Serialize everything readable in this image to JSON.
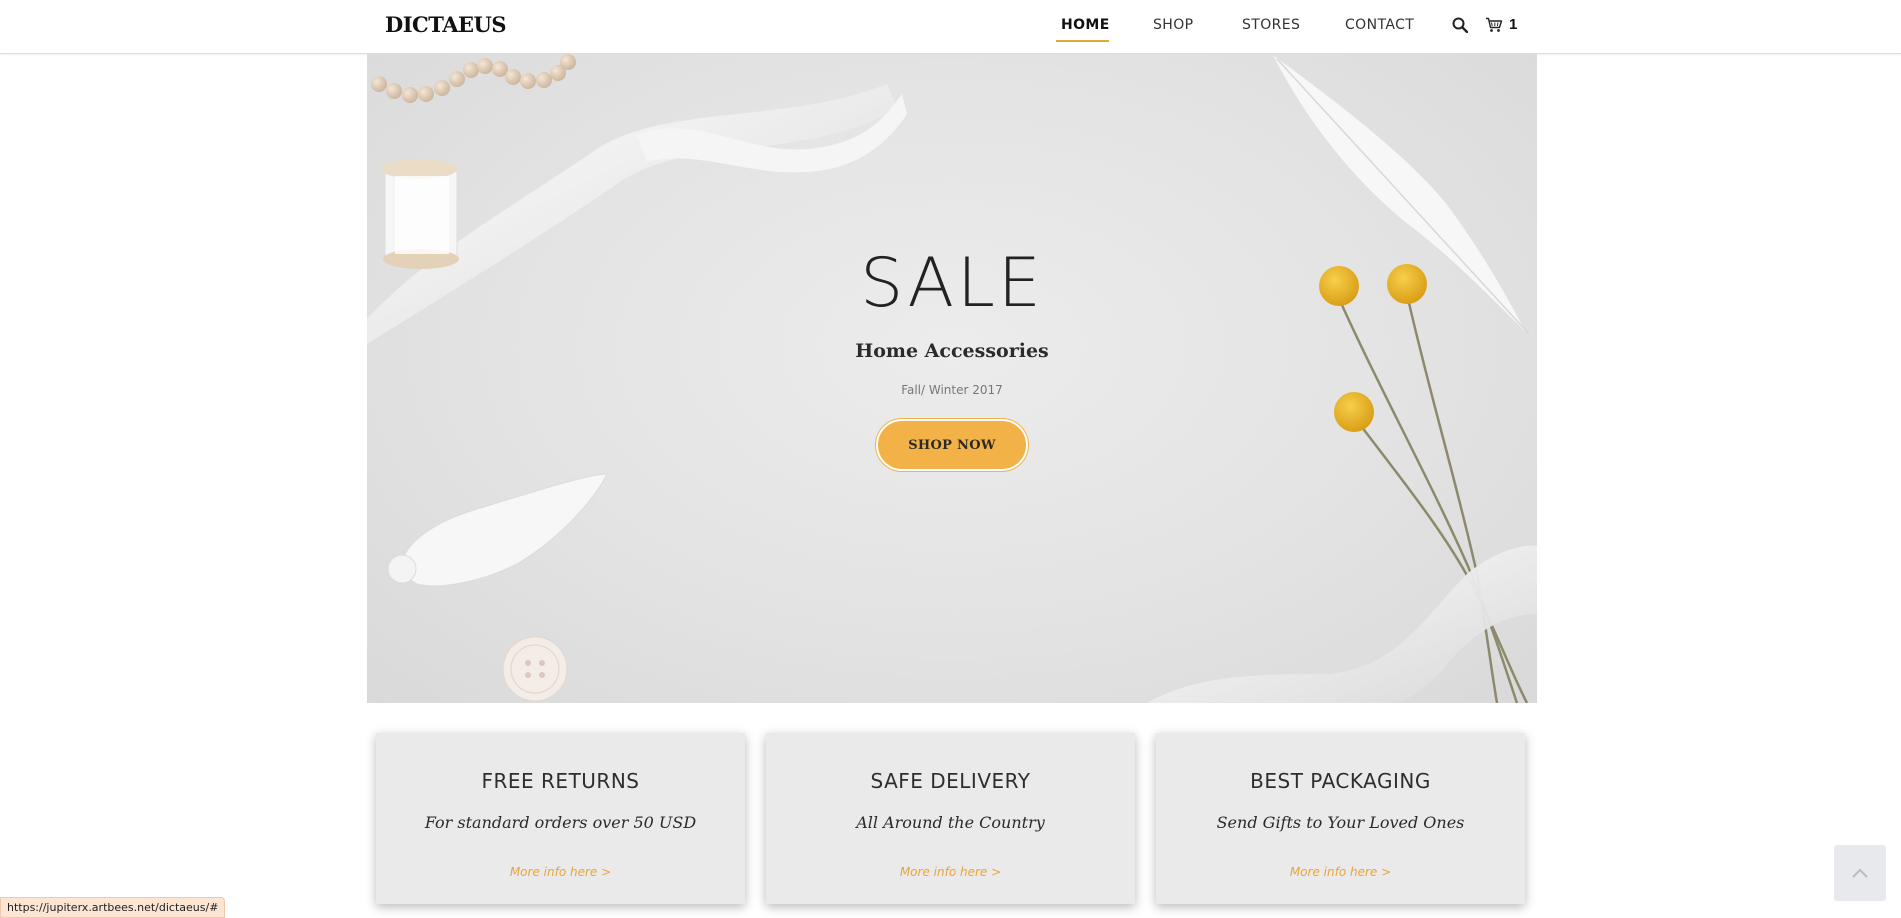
{
  "header": {
    "logo": "DICTAEUS",
    "nav": [
      {
        "label": "HOME"
      },
      {
        "label": "SHOP"
      },
      {
        "label": "STORES"
      },
      {
        "label": "CONTACT"
      }
    ],
    "active_nav": "HOME",
    "cart_count": "1",
    "icons": {
      "search": "search-icon",
      "cart": "cart-icon"
    }
  },
  "hero": {
    "title": "SALE",
    "subtitle": "Home Accessories",
    "season": "Fall/ Winter 2017",
    "button": "SHOP NOW"
  },
  "features": [
    {
      "title": "FREE RETURNS",
      "text": "For standard orders over 50 USD",
      "link": "More info here >"
    },
    {
      "title": "SAFE DELIVERY",
      "text": "All Around the Country",
      "link": "More info here >"
    },
    {
      "title": "BEST PACKAGING",
      "text": "Send Gifts to Your Loved Ones",
      "link": "More info here >"
    }
  ],
  "status_bar": {
    "url": "https://jupiterx.artbees.net/dictaeus/#"
  },
  "colors": {
    "accent": "#f2b247",
    "link": "#e8a536",
    "hero_bg": "#e3e3e3",
    "card_bg": "#eaeaea"
  }
}
